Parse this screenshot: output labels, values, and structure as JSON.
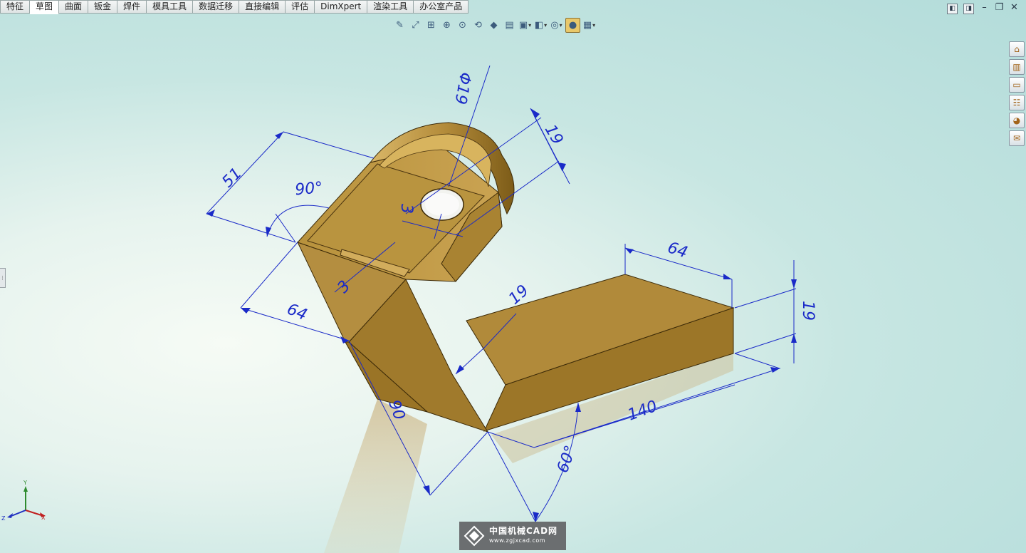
{
  "tabs": [
    {
      "label": "特征",
      "active": false
    },
    {
      "label": "草图",
      "active": true
    },
    {
      "label": "曲面",
      "active": false
    },
    {
      "label": "钣金",
      "active": false
    },
    {
      "label": "焊件",
      "active": false
    },
    {
      "label": "模具工具",
      "active": false
    },
    {
      "label": "数据迁移",
      "active": false
    },
    {
      "label": "直接编辑",
      "active": false
    },
    {
      "label": "评估",
      "active": false
    },
    {
      "label": "DimXpert",
      "active": false
    },
    {
      "label": "渲染工具",
      "active": false
    },
    {
      "label": "办公室产品",
      "active": false
    }
  ],
  "view_toolbar": [
    {
      "name": "paperclip-icon",
      "glyph": "✎",
      "dropdown": false
    },
    {
      "name": "zoom-to-fit-icon",
      "glyph": "⤢",
      "dropdown": false
    },
    {
      "name": "zoom-to-area-icon",
      "glyph": "⊞",
      "dropdown": false
    },
    {
      "name": "zoom-in-out-icon",
      "glyph": "⊕",
      "dropdown": false
    },
    {
      "name": "zoom-to-selection-icon",
      "glyph": "⊙",
      "dropdown": false
    },
    {
      "name": "rotate-view-icon",
      "glyph": "⟲",
      "dropdown": false
    },
    {
      "name": "3d-view-icon",
      "glyph": "◆",
      "dropdown": false
    },
    {
      "name": "section-view-icon",
      "glyph": "▤",
      "dropdown": false
    },
    {
      "name": "view-orientation-icon",
      "glyph": "▣",
      "dropdown": true
    },
    {
      "name": "display-style-icon",
      "glyph": "◧",
      "dropdown": true
    },
    {
      "name": "hide-show-items-icon",
      "glyph": "◎",
      "dropdown": true
    },
    {
      "name": "edit-appearance-icon",
      "glyph": "●",
      "dropdown": false,
      "active": true
    },
    {
      "name": "apply-scene-icon",
      "glyph": "▦",
      "dropdown": true
    }
  ],
  "window_controls": [
    {
      "name": "tile-left-icon",
      "glyph": "◧"
    },
    {
      "name": "tile-right-icon",
      "glyph": "◨"
    },
    {
      "name": "minimize-icon",
      "glyph": "–"
    },
    {
      "name": "restore-icon",
      "glyph": "❐"
    },
    {
      "name": "close-icon",
      "glyph": "✕"
    }
  ],
  "task_pane": [
    {
      "name": "solidworks-resources-icon",
      "glyph": "⌂"
    },
    {
      "name": "design-library-icon",
      "glyph": "▥"
    },
    {
      "name": "file-explorer-icon",
      "glyph": "▭"
    },
    {
      "name": "view-palette-icon",
      "glyph": "☷"
    },
    {
      "name": "appearances-scenes-icon",
      "glyph": "◕"
    },
    {
      "name": "custom-properties-icon",
      "glyph": "✉"
    }
  ],
  "colors": {
    "dimension": "#1a2ac8",
    "part_light": "#c49a43",
    "part_dark": "#8e6a20",
    "viewport_center": "#f6fbf5",
    "viewport_edge": "#b3dcda"
  },
  "dimensions": {
    "d_phi19": "Φ19",
    "d_19_top": "19",
    "d_51": "51",
    "d_90_angle": "90°",
    "d_3_hole": "3",
    "d_3_rib": "3",
    "d_64_left": "64",
    "d_19_mid": "19",
    "d_64_right": "64",
    "d_19_right": "19",
    "d_90": "90",
    "d_140": "140",
    "d_60_angle": "60°"
  },
  "triad": {
    "x": "X",
    "y": "Y",
    "z": "Z"
  },
  "watermark": {
    "cn": "中国机械CAD网",
    "url": "www.zgjxcad.com"
  }
}
